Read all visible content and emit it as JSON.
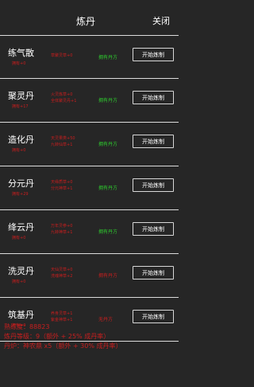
{
  "header": {
    "title": "炼丹",
    "close_label": "关闭"
  },
  "colors": {
    "background": "#262626",
    "red": "#c81e1e",
    "green": "#2ecc2e",
    "divider": "#dcdcdc"
  },
  "pills": [
    {
      "name": "练气散",
      "owned": "拥有+0",
      "materials": [
        "草聚灵草+0"
      ],
      "status": "拥有丹方",
      "status_color": "#2ecc2e",
      "button": "开始炼制"
    },
    {
      "name": "聚灵丹",
      "owned": "拥有+17",
      "materials": [
        "火灵炼草+0",
        "全体聚灵丹+1"
      ],
      "status": "拥有丹方",
      "status_color": "#2ecc2e",
      "button": "开始炼制"
    },
    {
      "name": "造化丹",
      "owned": "拥有+0",
      "materials": [
        "天灵果类+50",
        "九转仙草+1"
      ],
      "status": "拥有丹方",
      "status_color": "#2ecc2e",
      "button": "开始炼制"
    },
    {
      "name": "分元丹",
      "owned": "拥有+29",
      "materials": [
        "天缘质草+0",
        "分元神草+1"
      ],
      "status": "拥有丹方",
      "status_color": "#2ecc2e",
      "button": "开始炼制"
    },
    {
      "name": "绛云丹",
      "owned": "拥有+0",
      "materials": [
        "万年灵参+0",
        "九转神草+1"
      ],
      "status": "拥有丹方",
      "status_color": "#2ecc2e",
      "button": "开始炼制"
    },
    {
      "name": "洗灵丹",
      "owned": "拥有+0",
      "materials": [
        "天仙灵草+0",
        "洗魂神草+2"
      ],
      "status": "拥有丹方",
      "status_color": "#c81e1e",
      "button": "开始炼制"
    },
    {
      "name": "筑基丹",
      "owned": "拥有+0",
      "materials": [
        "养身灵草+1",
        "紫金神草+1"
      ],
      "status": "无丹方",
      "status_color": "#c81e1e",
      "button": "开始炼制"
    }
  ],
  "footer": {
    "proficiency": "熟练度：88823",
    "level": "炼丹等级：9（额外 + 25% 成丹率）",
    "furnace": "丹炉：神农鼎 x5（额外 + 30% 成丹率）"
  }
}
